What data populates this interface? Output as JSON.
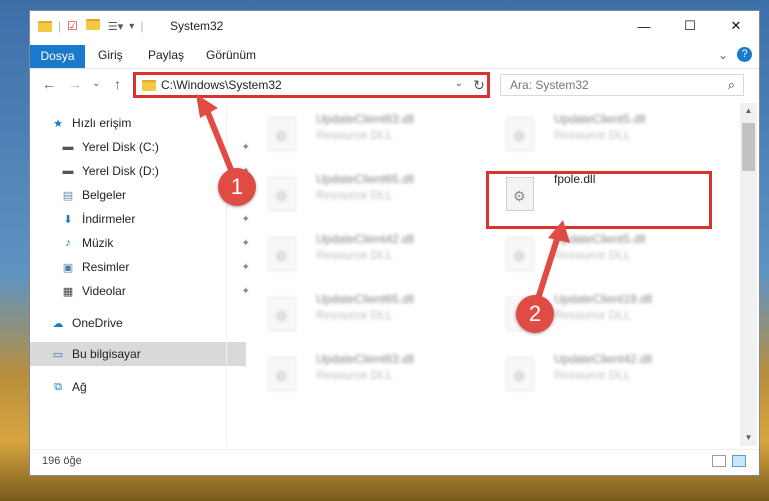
{
  "window": {
    "title": "System32",
    "minimize": "—",
    "maximize": "☐",
    "close": "✕"
  },
  "ribbon": {
    "tabs": [
      "Dosya",
      "Giriş",
      "Paylaş",
      "Görünüm"
    ],
    "help": "?",
    "expand": "⌄"
  },
  "nav": {
    "back": "←",
    "forward": "→",
    "recent": "⌄",
    "up": "↑",
    "address": "C:\\Windows\\System32",
    "address_dropdown": "⌄",
    "refresh": "↻",
    "search_placeholder": "Ara: System32",
    "search_icon": "⌕"
  },
  "sidebar": {
    "items": [
      {
        "label": "Hızlı erişim",
        "icon": "star-icon",
        "glyph": "★",
        "color": "#1979ca",
        "pinned": false
      },
      {
        "label": "Yerel Disk (C:)",
        "icon": "drive-icon",
        "glyph": "▬",
        "color": "#555555",
        "pinned": true
      },
      {
        "label": "Yerel Disk (D:)",
        "icon": "drive-icon",
        "glyph": "▬",
        "color": "#555555",
        "pinned": true
      },
      {
        "label": "Belgeler",
        "icon": "documents-icon",
        "glyph": "▤",
        "color": "#6a87b5",
        "pinned": true
      },
      {
        "label": "İndirmeler",
        "icon": "download-icon",
        "glyph": "⬇",
        "color": "#1979ca",
        "pinned": true
      },
      {
        "label": "Müzik",
        "icon": "music-icon",
        "glyph": "♪",
        "color": "#1979ca",
        "pinned": true
      },
      {
        "label": "Resimler",
        "icon": "pictures-icon",
        "glyph": "▣",
        "color": "#4f7fb0",
        "pinned": true
      },
      {
        "label": "Videolar",
        "icon": "video-icon",
        "glyph": "▦",
        "color": "#444444",
        "pinned": true
      },
      {
        "label": "OneDrive",
        "icon": "cloud-icon",
        "glyph": "☁",
        "color": "#1979ca",
        "pinned": false
      },
      {
        "label": "Bu bilgisayar",
        "icon": "computer-icon",
        "glyph": "▭",
        "color": "#1979ca",
        "pinned": false,
        "selected": true
      },
      {
        "label": "Ağ",
        "icon": "network-icon",
        "glyph": "⧉",
        "color": "#1979ca",
        "pinned": false
      }
    ],
    "pin_glyph": "📌"
  },
  "files": [
    {
      "name": "UpdateClient63.dll",
      "desc": "Resource DLL"
    },
    {
      "name": "UpdateClient5.dll",
      "desc": "Resource DLL"
    },
    {
      "name": "UpdateClient65.dll",
      "desc": "Resource DLL"
    },
    {
      "name": "fpole.dll",
      "desc": ""
    },
    {
      "name": "UpdateClient42.dll",
      "desc": "Resource DLL"
    },
    {
      "name": "UpdateClient5.dll",
      "desc": "Resource DLL"
    },
    {
      "name": "UpdateClient65.dll",
      "desc": "Resource DLL"
    },
    {
      "name": "UpdateClient19.dll",
      "desc": "Resource DLL"
    },
    {
      "name": "UpdateClient63.dll",
      "desc": "Resource DLL"
    },
    {
      "name": "UpdateClient42.dll",
      "desc": "Resource DLL"
    }
  ],
  "status": {
    "count": "196 öğe"
  },
  "annotations": {
    "step1": "1",
    "step2": "2",
    "color": "#d9332f"
  }
}
